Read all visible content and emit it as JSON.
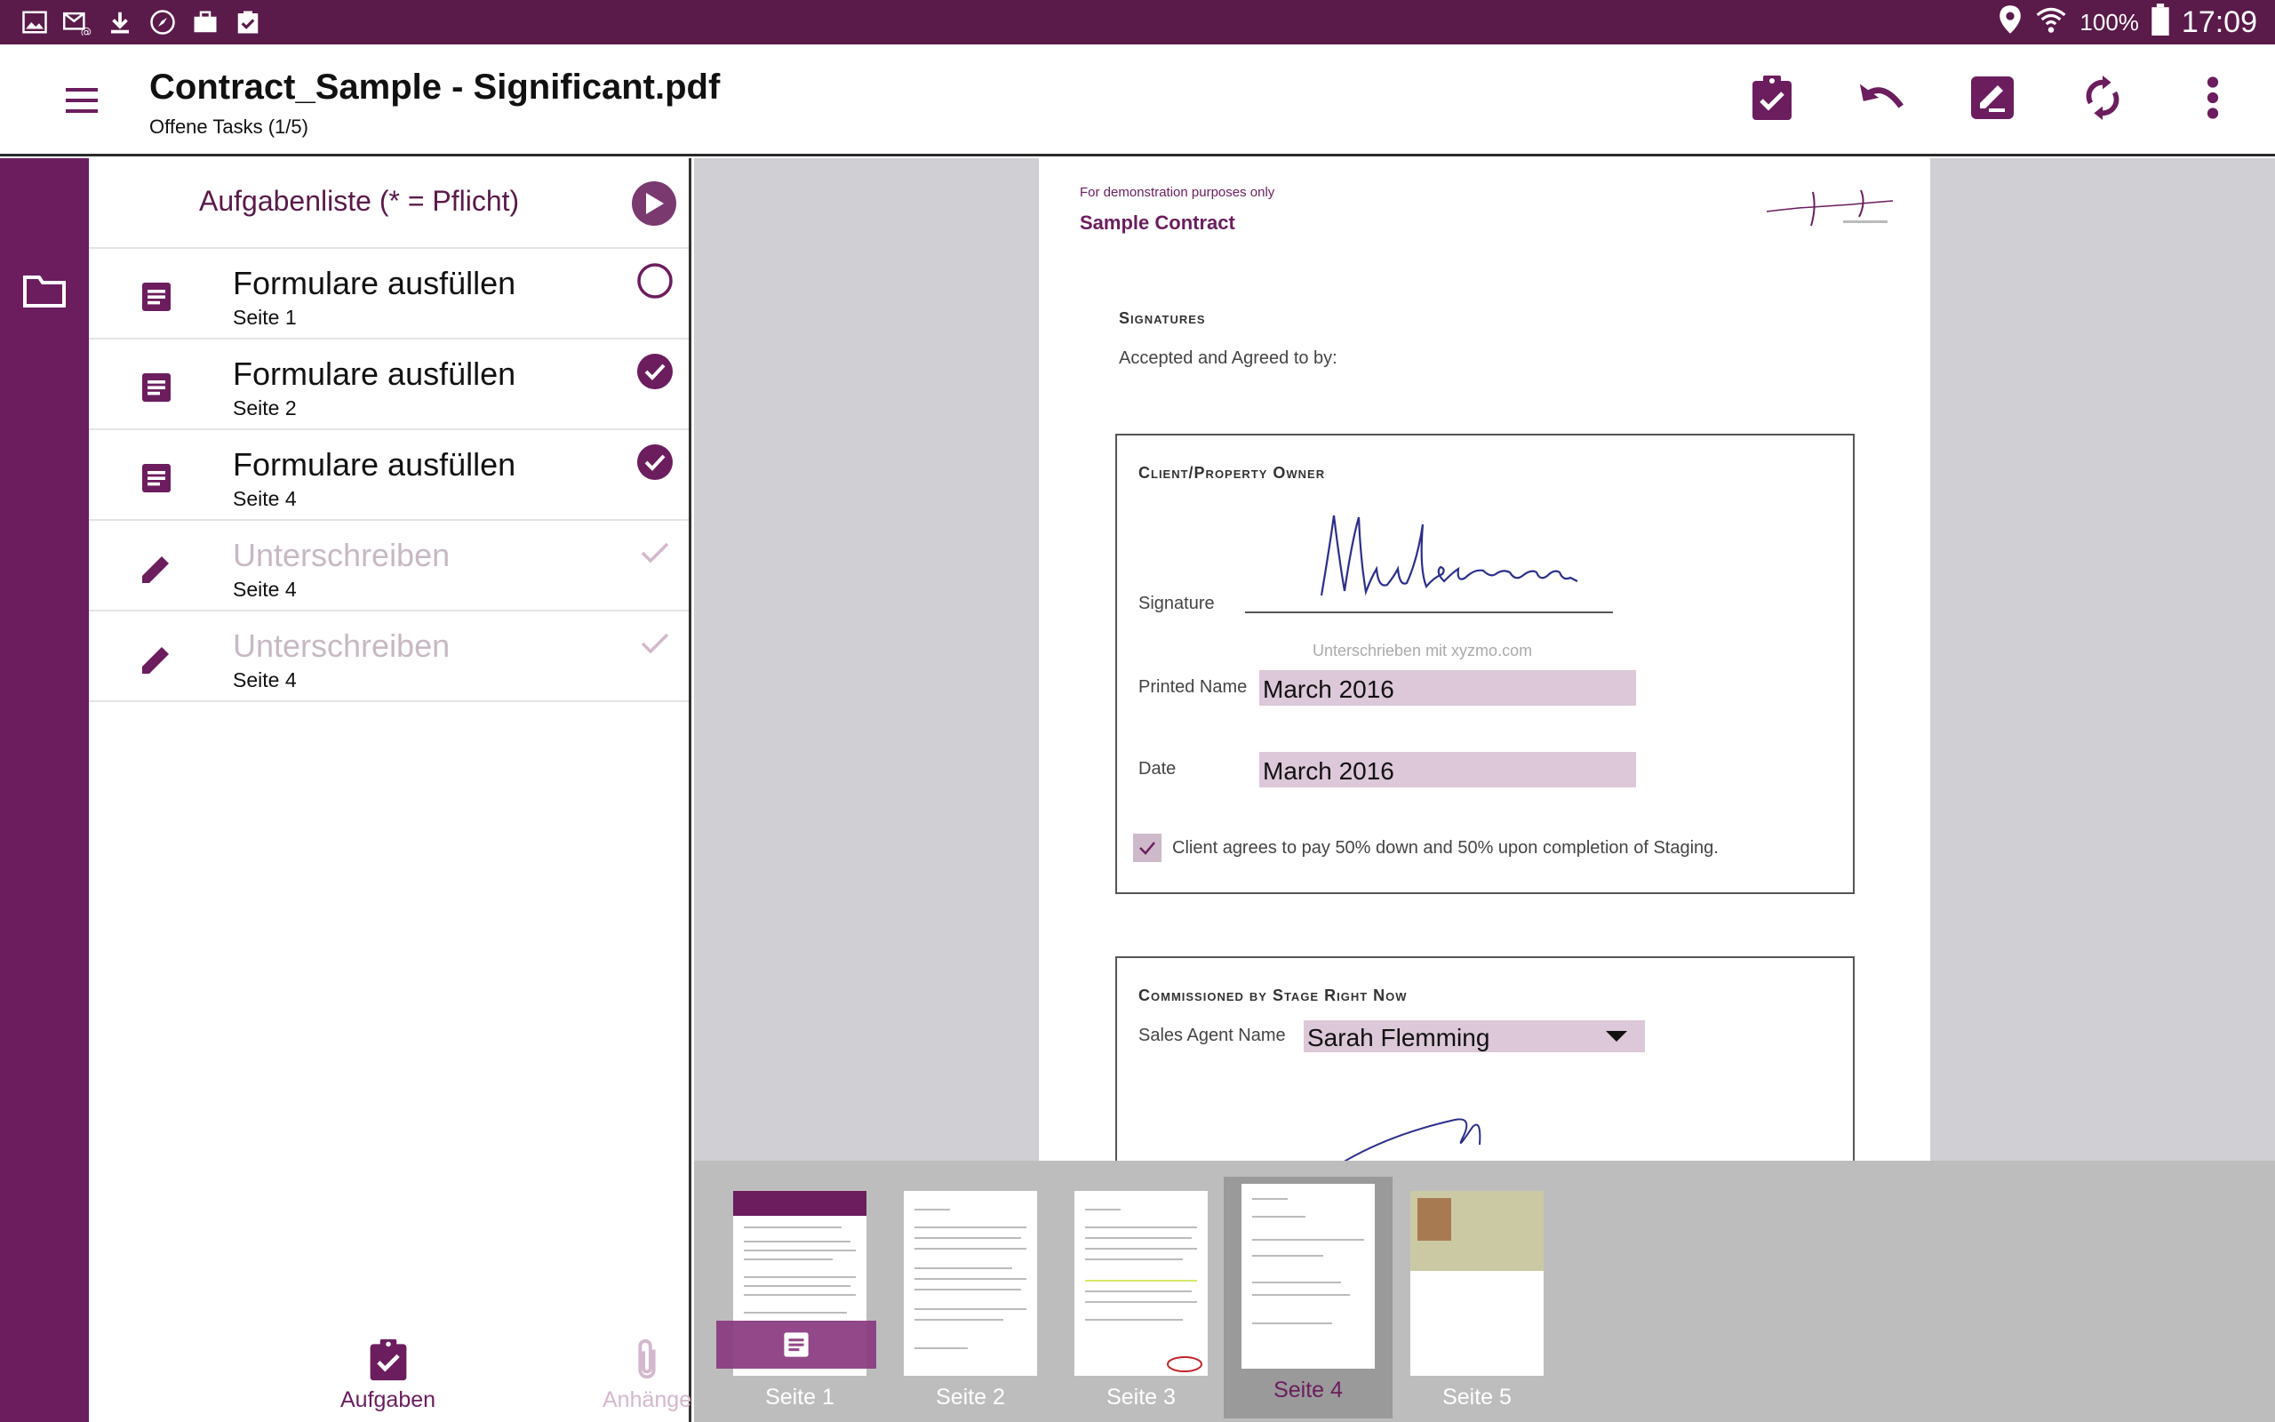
{
  "status_bar": {
    "battery": "100%",
    "time": "17:09",
    "left_icons": [
      "gallery-icon",
      "mail-icon",
      "download-icon",
      "compass-icon",
      "briefcase-icon",
      "clipboard-check-icon"
    ]
  },
  "app_bar": {
    "title": "Contract_Sample - Significant.pdf",
    "subtitle": "Offene Tasks (1/5)",
    "actions": [
      "clipboard-check-icon",
      "undo-icon",
      "edit-icon",
      "sync-icon",
      "more-vert-icon"
    ]
  },
  "task_panel": {
    "title": "Aufgabenliste (* = Pflicht)",
    "tasks": [
      {
        "name": "Formulare ausfüllen",
        "page": "Seite 1",
        "icon": "form-icon",
        "state": "open"
      },
      {
        "name": "Formulare ausfüllen",
        "page": "Seite 2",
        "icon": "form-icon",
        "state": "done"
      },
      {
        "name": "Formulare ausfüllen",
        "page": "Seite 4",
        "icon": "form-icon",
        "state": "done"
      },
      {
        "name": "Unterschreiben",
        "page": "Seite 4",
        "icon": "pencil-icon",
        "state": "done-disabled"
      },
      {
        "name": "Unterschreiben",
        "page": "Seite 4",
        "icon": "pencil-icon",
        "state": "done-disabled"
      }
    ],
    "tabs": {
      "tasks": "Aufgaben",
      "attachments": "Anhänge"
    }
  },
  "document": {
    "demo_note": "For demonstration purposes only",
    "doc_title": "Sample Contract",
    "signatures_heading": "Signatures",
    "accepted_text": "Accepted and Agreed to by:",
    "client_heading": "Client/Property Owner",
    "signature_label": "Signature",
    "signature_caption": "Unterschrieben mit xyzmo.com",
    "printed_name_label": "Printed Name",
    "printed_name_value": "March 2016",
    "date_label": "Date",
    "date_value": "March 2016",
    "agreement_text": "Client agrees to pay 50% down and 50% upon completion of Staging.",
    "commissioned_heading": "Commissioned by Stage Right Now",
    "sales_agent_label": "Sales Agent Name",
    "sales_agent_value": "Sarah Flemming"
  },
  "thumbnails": [
    {
      "label": "Seite 1"
    },
    {
      "label": "Seite 2"
    },
    {
      "label": "Seite 3"
    },
    {
      "label": "Seite 4"
    },
    {
      "label": "Seite 5"
    }
  ],
  "selected_page": "Seite 4",
  "colors": {
    "brand": "#6b1d5e",
    "status_bar": "#5a1a4a",
    "field_fill": "#dcc8d8",
    "disabled_text": "#c7b8c4"
  }
}
